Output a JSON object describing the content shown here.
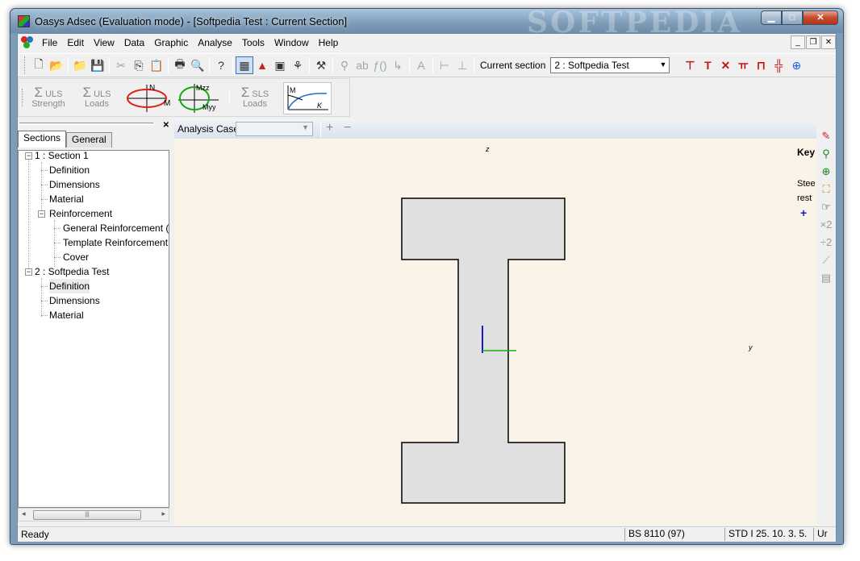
{
  "window": {
    "title": "Oasys Adsec (Evaluation mode) - [Softpedia Test : Current Section]",
    "watermark": "SOFTPEDIA"
  },
  "menu": [
    "File",
    "Edit",
    "View",
    "Data",
    "Graphic",
    "Analyse",
    "Tools",
    "Window",
    "Help"
  ],
  "toolbar": {
    "current_section_label": "Current section",
    "current_section_value": "2 : Softpedia Test"
  },
  "toolbar2": {
    "uls_strength": [
      "ULS",
      "Strength"
    ],
    "uls_loads": [
      "ULS",
      "Loads"
    ],
    "sls_loads": [
      "SLS",
      "Loads"
    ],
    "nm_labels": [
      "N",
      "M"
    ],
    "mzz_labels": [
      "Mzz",
      "Myy"
    ],
    "mk_labels": [
      "M",
      "K"
    ]
  },
  "panel": {
    "tabs": [
      "Sections",
      "General"
    ],
    "active_tab": "Sections",
    "tree": [
      {
        "label": "1 : Section 1"
      },
      {
        "label": "Definition"
      },
      {
        "label": "Dimensions"
      },
      {
        "label": "Material"
      },
      {
        "label": "Reinforcement"
      },
      {
        "label": "General Reinforcement ("
      },
      {
        "label": "Template Reinforcement"
      },
      {
        "label": "Cover"
      },
      {
        "label": "2 : Softpedia Test"
      },
      {
        "label": "Definition"
      },
      {
        "label": "Dimensions"
      },
      {
        "label": "Material"
      }
    ]
  },
  "document": {
    "analysis_case_label": "Analysis Case",
    "axis_z": "z",
    "axis_y": "y",
    "key_title": "Key",
    "key_lines": [
      "Steel",
      "rest"
    ],
    "key_marker": "+",
    "colors": {
      "canvas": "#faf3e7",
      "section_fill": "#e0e0e0",
      "z_axis": "#1a1ac8",
      "y_axis": "#12b012"
    }
  },
  "status": {
    "ready": "Ready",
    "code": "BS 8110 (97)",
    "section": "STD I 25. 10. 3. 5.",
    "units": "Ur"
  }
}
